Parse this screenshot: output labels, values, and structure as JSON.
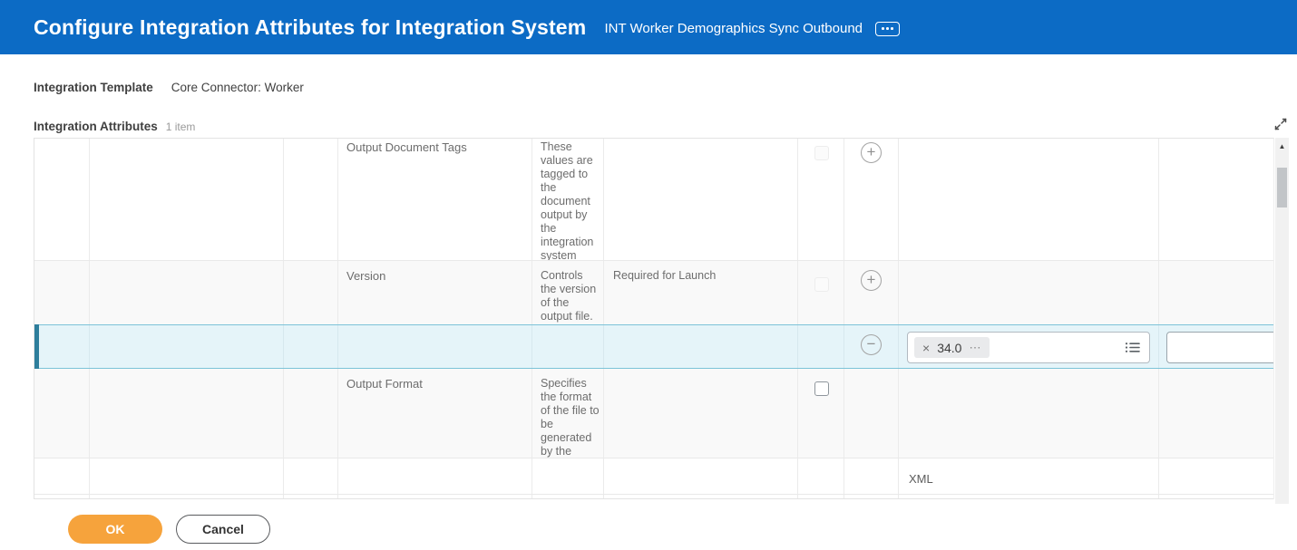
{
  "header": {
    "title": "Configure Integration Attributes for Integration System",
    "subtitle": "INT Worker Demographics Sync Outbound"
  },
  "template": {
    "label": "Integration Template",
    "value": "Core Connector: Worker"
  },
  "grid": {
    "title": "Integration Attributes",
    "item_count": "1 item",
    "rows": [
      {
        "name": "Output Document Tags",
        "description": "These values are tagged to the document output by the integration system",
        "comment": "",
        "checkbox": "disabled",
        "row_action": "add"
      },
      {
        "name": "Version",
        "description": "Controls the version of the output file.",
        "comment": "Required for Launch",
        "checkbox": "disabled",
        "row_action": "add"
      },
      {
        "name": "",
        "description": "",
        "comment": "",
        "selected": true,
        "row_action": "remove",
        "value": {
          "selected_item": "34.0"
        },
        "extra_value": ""
      },
      {
        "name": "Output Format",
        "description": "Specifies the format of the file to be generated by the integration.",
        "comment": "",
        "checkbox": "enabled",
        "row_action": ""
      },
      {
        "name": "",
        "description": "",
        "comment": "",
        "value_text": "XML"
      }
    ]
  },
  "icons": {
    "related_actions": "⋯",
    "add": "+",
    "remove": "−",
    "delete_selection": "×",
    "scroll_up": "▲"
  },
  "colors": {
    "header_bg": "#0c6bc5",
    "selected_row_bg": "#e5f4f9",
    "selected_row_border": "#7cc3d8",
    "selected_row_accent": "#2e7e9c",
    "primary_button": "#f6a33c"
  },
  "buttons": {
    "ok": "OK",
    "cancel": "Cancel"
  }
}
